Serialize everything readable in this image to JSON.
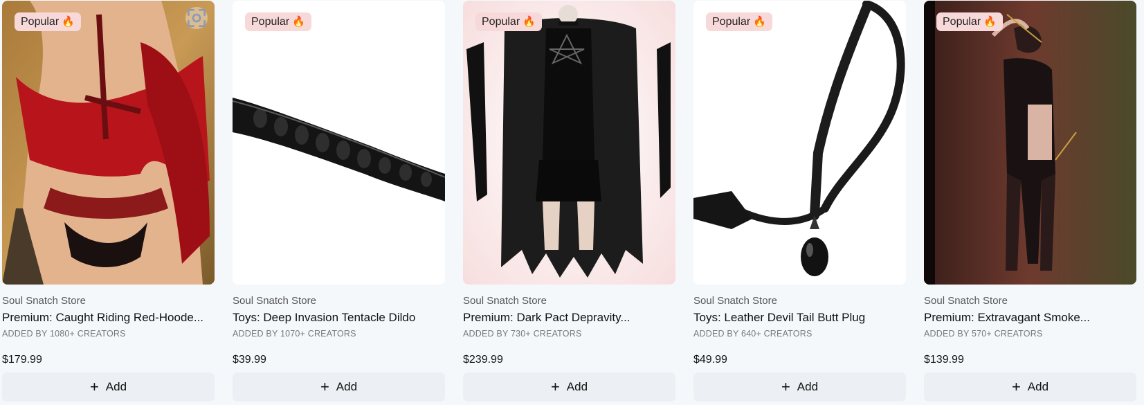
{
  "products": [
    {
      "badge": "Popular",
      "badge_icon": "fire-icon",
      "store": "Soul Snatch Store",
      "title": "Premium: Caught Riding Red-Hoode...",
      "added": "ADDED BY 1080+ CREATORS",
      "price": "$179.99",
      "add_label": "Add"
    },
    {
      "badge": "Popular",
      "badge_icon": "fire-icon",
      "store": "Soul Snatch Store",
      "title": "Toys: Deep Invasion Tentacle Dildo",
      "added": "ADDED BY 1070+ CREATORS",
      "price": "$39.99",
      "add_label": "Add"
    },
    {
      "badge": "Popular",
      "badge_icon": "fire-icon",
      "store": "Soul Snatch Store",
      "title": "Premium: Dark Pact Depravity...",
      "added": "ADDED BY 730+ CREATORS",
      "price": "$239.99",
      "add_label": "Add"
    },
    {
      "badge": "Popular",
      "badge_icon": "fire-icon",
      "store": "Soul Snatch Store",
      "title": "Toys: Leather Devil Tail Butt Plug",
      "added": "ADDED BY 640+ CREATORS",
      "price": "$49.99",
      "add_label": "Add"
    },
    {
      "badge": "Popular",
      "badge_icon": "fire-icon",
      "store": "Soul Snatch Store",
      "title": "Premium: Extravagant Smoke...",
      "added": "ADDED BY 570+ CREATORS",
      "price": "$139.99",
      "add_label": "Add"
    }
  ],
  "colors": {
    "page_bg": "#f5f8fb",
    "badge_bg": "#f8d9d9",
    "button_bg": "#eceff3"
  }
}
